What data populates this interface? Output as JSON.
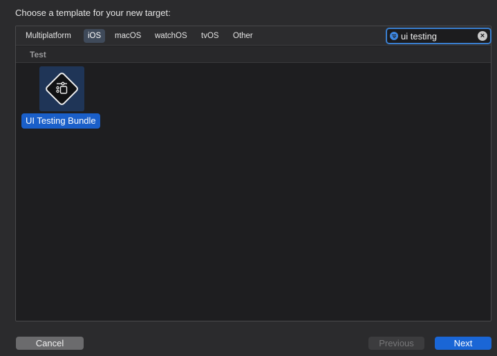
{
  "header": {
    "title": "Choose a template for your new target:"
  },
  "tabs": [
    {
      "label": "Multiplatform",
      "active": false
    },
    {
      "label": "iOS",
      "active": true
    },
    {
      "label": "macOS",
      "active": false
    },
    {
      "label": "watchOS",
      "active": false
    },
    {
      "label": "tvOS",
      "active": false
    },
    {
      "label": "Other",
      "active": false
    }
  ],
  "search": {
    "value": "ui testing",
    "placeholder": "Filter"
  },
  "sections": [
    {
      "title": "Test",
      "templates": [
        {
          "label": "UI Testing Bundle",
          "icon": "ui-testing-bundle-icon",
          "selected": true
        }
      ]
    }
  ],
  "footer": {
    "cancel_label": "Cancel",
    "previous_label": "Previous",
    "next_label": "Next",
    "previous_enabled": false
  },
  "colors": {
    "accent": "#1a66d6",
    "selection": "#1a5fc9",
    "search_focus": "#3a7fd0"
  }
}
